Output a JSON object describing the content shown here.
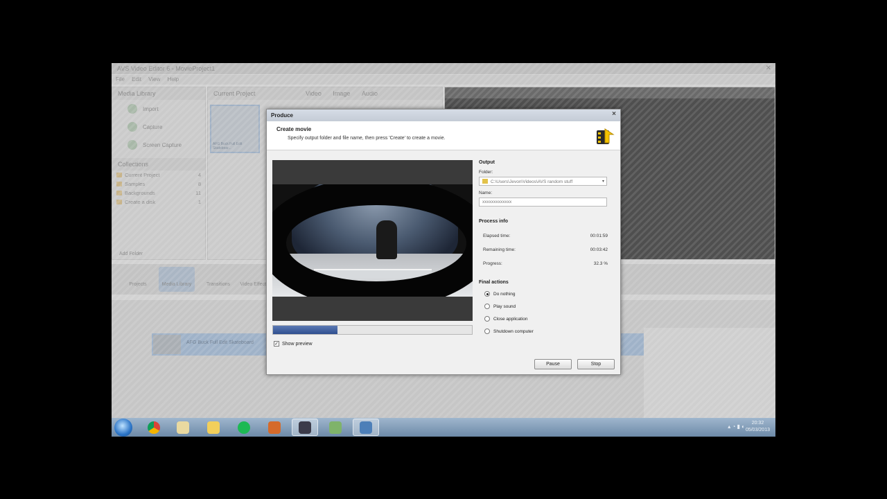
{
  "background_app": {
    "title": "AVS Video Editor 6 - MovieProject1",
    "menu": [
      "File",
      "Edit",
      "View",
      "Help"
    ],
    "media_library": {
      "header": "Media Library",
      "buttons": [
        "Import",
        "Capture",
        "Screen Capture"
      ],
      "collections_header": "Collections",
      "collections": [
        {
          "label": "Current Project",
          "count": "4"
        },
        {
          "label": "Samples",
          "count": "8"
        },
        {
          "label": "Backgrounds",
          "count": "11"
        },
        {
          "label": "Create a disk",
          "count": "1"
        }
      ],
      "add_folder": "Add Folder"
    },
    "project_header": "Current Project",
    "project_filters": [
      "Video",
      "Image",
      "Audio"
    ],
    "thumb_label": "AFG Buck Full Edit Skateboar...",
    "tools": [
      "Projects",
      "Media Library",
      "Transitions",
      "Video Effects"
    ],
    "timeline_clip_label": "AFG Buck Full Edit Skateboard"
  },
  "taskbar": {
    "items": [
      "chrome",
      "file-explorer",
      "folder",
      "spotify",
      "media-player",
      "avs-video-editor",
      "network-app",
      "display-app"
    ],
    "clock_time": "20:32",
    "clock_date": "05/03/2013"
  },
  "dialog": {
    "title": "Produce",
    "close": "×",
    "header_title": "Create movie",
    "header_subtitle": "Specify output folder and file name, then press 'Create' to create a movie.",
    "show_preview_label": "Show preview",
    "show_preview_checked": true,
    "progress_fraction": 0.323,
    "output": {
      "section": "Output",
      "folder_label": "Folder:",
      "folder_value": "C:\\Users\\Jevon\\Videos\\AVS random stuff",
      "name_label": "Name:",
      "name_value": "xxxxxxxxxxxxx"
    },
    "process": {
      "section": "Process info",
      "rows": [
        {
          "label": "Elapsed time:",
          "value": "00:01:59"
        },
        {
          "label": "Remaining time:",
          "value": "00:03:42"
        },
        {
          "label": "Progress:",
          "value": "32.3 %"
        }
      ]
    },
    "final_actions": {
      "section": "Final actions",
      "options": [
        {
          "label": "Do nothing",
          "selected": true
        },
        {
          "label": "Play sound",
          "selected": false
        },
        {
          "label": "Close application",
          "selected": false
        },
        {
          "label": "Shutdown computer",
          "selected": false
        }
      ]
    },
    "pause_label": "Pause",
    "stop_label": "Stop"
  }
}
